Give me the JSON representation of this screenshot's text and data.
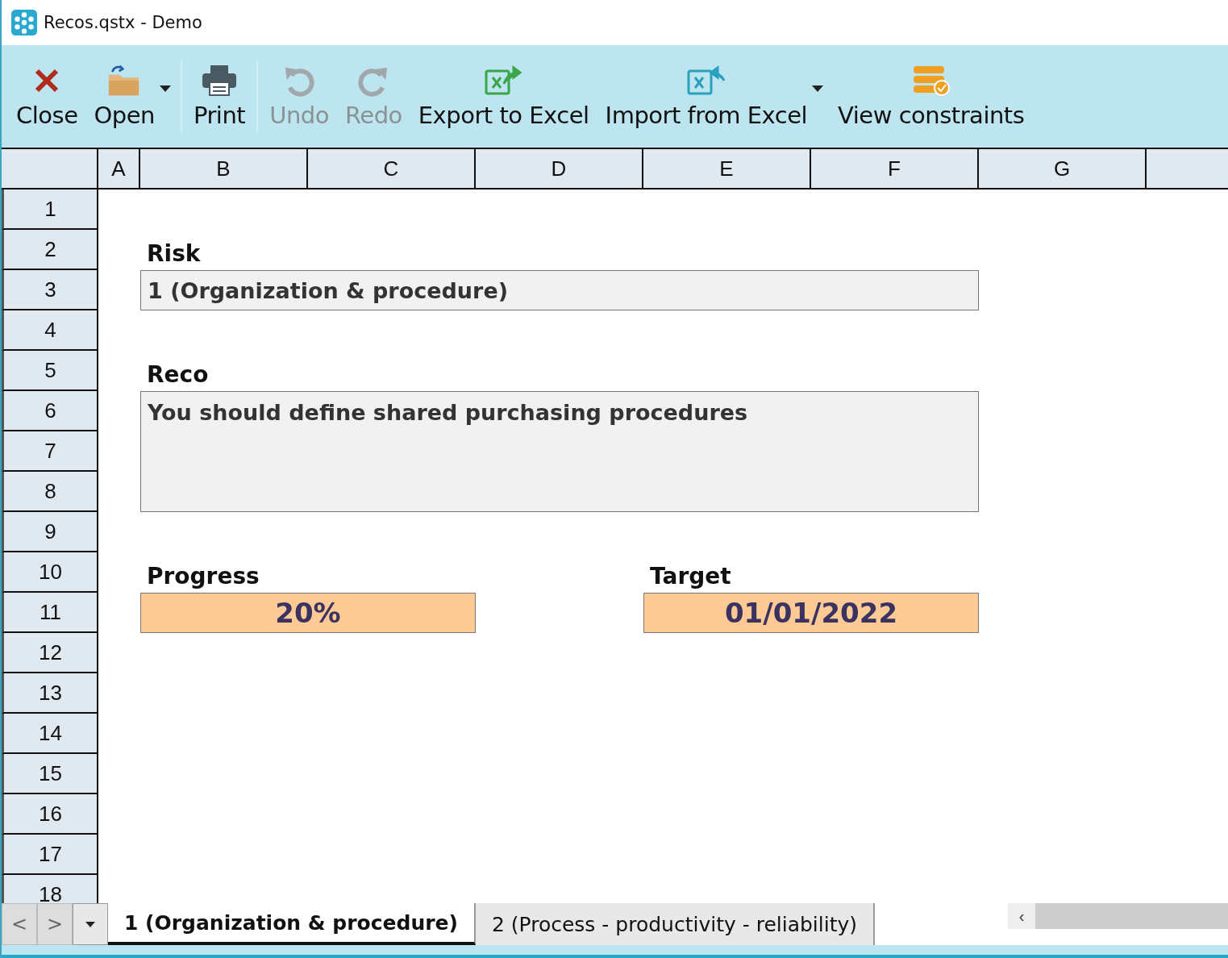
{
  "window": {
    "title": "Recos.qstx - Demo"
  },
  "toolbar": [
    {
      "kind": "close",
      "label": "Close",
      "disabled": false,
      "dropdown": false,
      "separator": false
    },
    {
      "kind": "open",
      "label": "Open",
      "disabled": false,
      "dropdown": true,
      "separator": true
    },
    {
      "kind": "print",
      "label": "Print",
      "disabled": false,
      "dropdown": false,
      "separator": true
    },
    {
      "kind": "undo",
      "label": "Undo",
      "disabled": true,
      "dropdown": false,
      "separator": false
    },
    {
      "kind": "redo",
      "label": "Redo",
      "disabled": true,
      "dropdown": false,
      "separator": false
    },
    {
      "kind": "export",
      "label": "Export to Excel",
      "disabled": false,
      "dropdown": false,
      "separator": false
    },
    {
      "kind": "import",
      "label": "Import from Excel",
      "disabled": false,
      "dropdown": true,
      "separator": false
    },
    {
      "kind": "constraints",
      "label": "View constraints",
      "disabled": false,
      "dropdown": false,
      "separator": false
    }
  ],
  "sheet": {
    "columns": [
      "A",
      "B",
      "C",
      "D",
      "E",
      "F",
      "G"
    ],
    "rows": [
      "1",
      "2",
      "3",
      "4",
      "5",
      "6",
      "7",
      "8",
      "9",
      "10",
      "11",
      "12",
      "13",
      "14",
      "15",
      "16",
      "17",
      "18"
    ],
    "form": {
      "risk_label": "Risk",
      "risk_value": "1 (Organization & procedure)",
      "reco_label": "Reco",
      "reco_value": "You should define shared purchasing procedures",
      "progress_label": "Progress",
      "progress_value": "20%",
      "target_label": "Target",
      "target_value": "01/01/2022"
    }
  },
  "sheet_tabs": [
    {
      "label": "1 (Organization & procedure)",
      "selected": true
    },
    {
      "label": "2 (Process - productivity - reliability)",
      "selected": false
    }
  ],
  "tab_nav": {
    "prev": "<",
    "next": ">",
    "scroll_left": "‹"
  }
}
